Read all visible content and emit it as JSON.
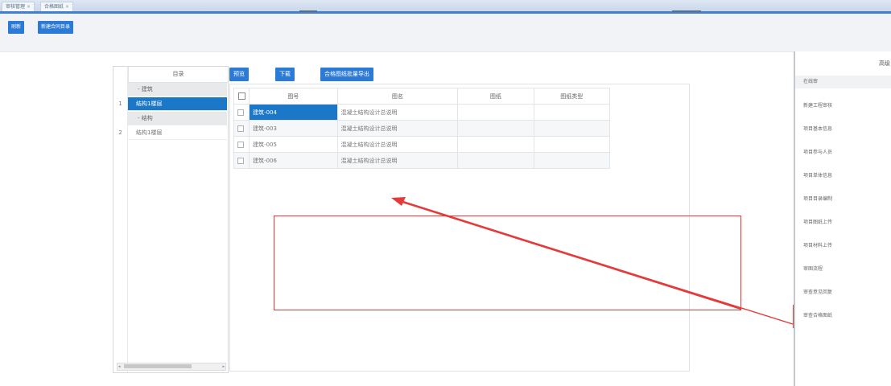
{
  "tabs": [
    {
      "label": "审核管理"
    },
    {
      "label": "合格图纸"
    }
  ],
  "toolbar": {
    "btn1": "刷新",
    "btn2": "新建合同目录"
  },
  "tree": {
    "header": "目录",
    "rows": [
      {
        "num": "",
        "label": "- 建筑",
        "kind": "group"
      },
      {
        "num": "1",
        "label": "结构1楼层",
        "kind": "selected"
      },
      {
        "num": "",
        "label": "- 结构",
        "kind": "group"
      },
      {
        "num": "2",
        "label": "结构1楼层",
        "kind": "plain"
      }
    ]
  },
  "actions": {
    "preview": "预览",
    "download": "下载",
    "export": "合格图纸批量导出"
  },
  "grid": {
    "columns": [
      "图号",
      "图名",
      "图纸",
      "图纸类型"
    ],
    "rows": [
      {
        "code": "建筑-004",
        "name": "混凝土结构设计总说明",
        "c3": "",
        "c4": ""
      },
      {
        "code": "建筑-003",
        "name": "混凝土结构设计总说明",
        "c3": "",
        "c4": ""
      },
      {
        "code": "建筑-005",
        "name": "混凝土结构设计总说明",
        "c3": "",
        "c4": ""
      },
      {
        "code": "建筑-006",
        "name": "混凝土结构设计总说明",
        "c3": "",
        "c4": ""
      }
    ]
  },
  "sidebar": {
    "title": "高级",
    "items": [
      {
        "label": "在线审"
      },
      {
        "label": "新建工程审核"
      },
      {
        "label": "项目基本信息"
      },
      {
        "label": "项目参与人员"
      },
      {
        "label": "项目单体信息"
      },
      {
        "label": "项目目录编制"
      },
      {
        "label": "项目图纸上传"
      },
      {
        "label": "项目材料上传"
      },
      {
        "label": "审图流程"
      },
      {
        "label": "审查意见回复"
      },
      {
        "label": "审查合格图纸"
      }
    ]
  },
  "colors": {
    "accent": "#2b7bd6",
    "selected_row": "#1b78c9",
    "annotation": "#e43a3a"
  }
}
